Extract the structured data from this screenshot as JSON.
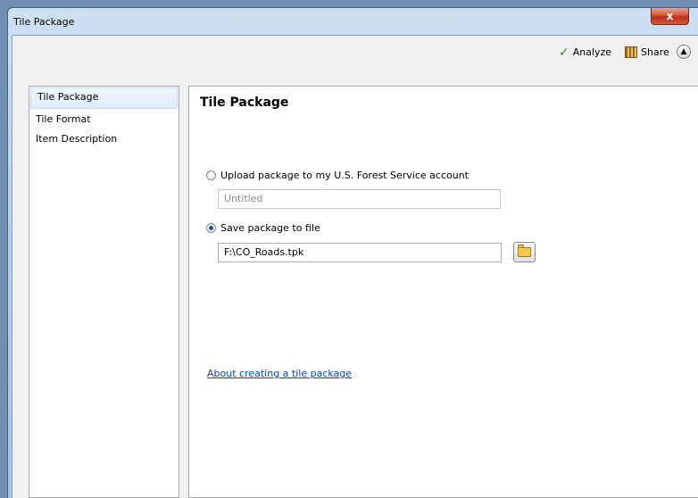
{
  "window": {
    "title": "Tile Package",
    "close_label": "x"
  },
  "toolbar": {
    "analyze_label": "Analyze",
    "share_label": "Share"
  },
  "nav": {
    "items": [
      "Tile Package",
      "Tile Format",
      "Item Description"
    ],
    "selected": 0
  },
  "panel": {
    "title": "Tile Package",
    "upload_option": {
      "label": "Upload package to my U.S. Forest Service account",
      "selected": false
    },
    "upload_field": {
      "value": "Untitled"
    },
    "save_option": {
      "label": "Save package to file",
      "selected": true
    },
    "save_field": {
      "value": "F:\\CO_Roads.tpk"
    },
    "help_link": "About creating a tile package"
  },
  "colors": {
    "link": "#0645ad",
    "analyze_check": "#2f8a2f",
    "close_button": "#c8432b"
  },
  "icons": [
    "close-icon",
    "checkmark-icon",
    "share-icon",
    "chevron-up-icon",
    "folder-icon"
  ]
}
